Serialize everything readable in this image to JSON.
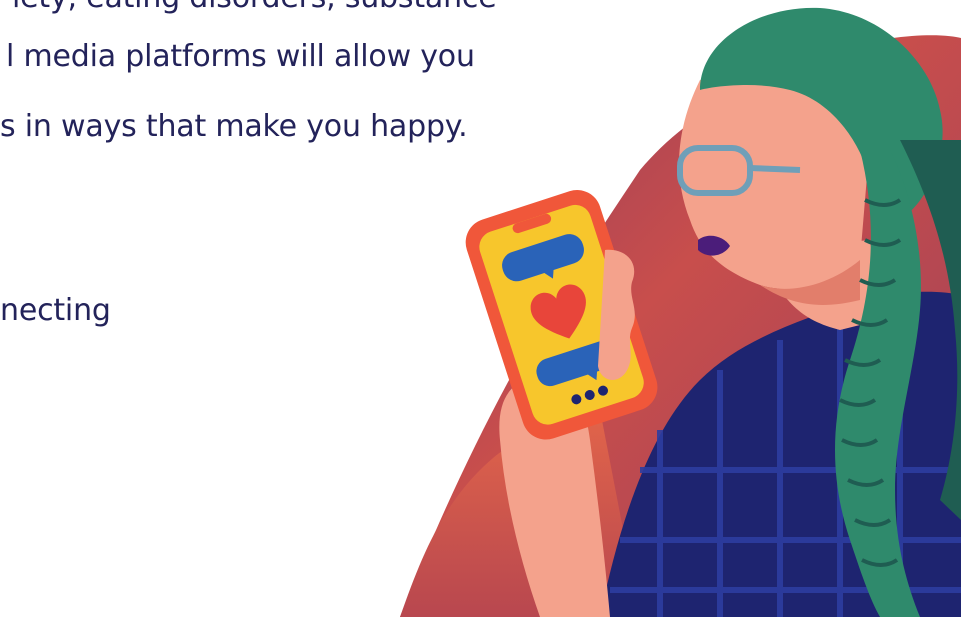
{
  "article": {
    "lines": [
      "iety, eating disorders, substance",
      "l media platforms will allow you",
      "s in ways that make you happy.",
      "necting"
    ]
  },
  "illustration": {
    "subject": "woman-with-braids-holding-phone",
    "icons": [
      "chat-bubble-icon",
      "heart-icon",
      "chat-bubble-icon",
      "typing-dots-icon"
    ],
    "colors": {
      "text": "#23235a",
      "blob_top": "#9b3f5a",
      "blob_mid": "#c44f4c",
      "blob_bottom": "#e0634a",
      "skin": "#f4a28c",
      "skin_shadow": "#e27e6b",
      "hair": "#2f8a6c",
      "hair_dark": "#1f5d52",
      "shirt": "#1e2470",
      "shirt_plaid": "#2d3da0",
      "phone_case": "#f0573a",
      "phone_screen": "#f7c62c",
      "bubble": "#2a63b8",
      "heart": "#e8453a",
      "glasses": "#6f9fb8",
      "lips": "#4b1d7a"
    }
  }
}
